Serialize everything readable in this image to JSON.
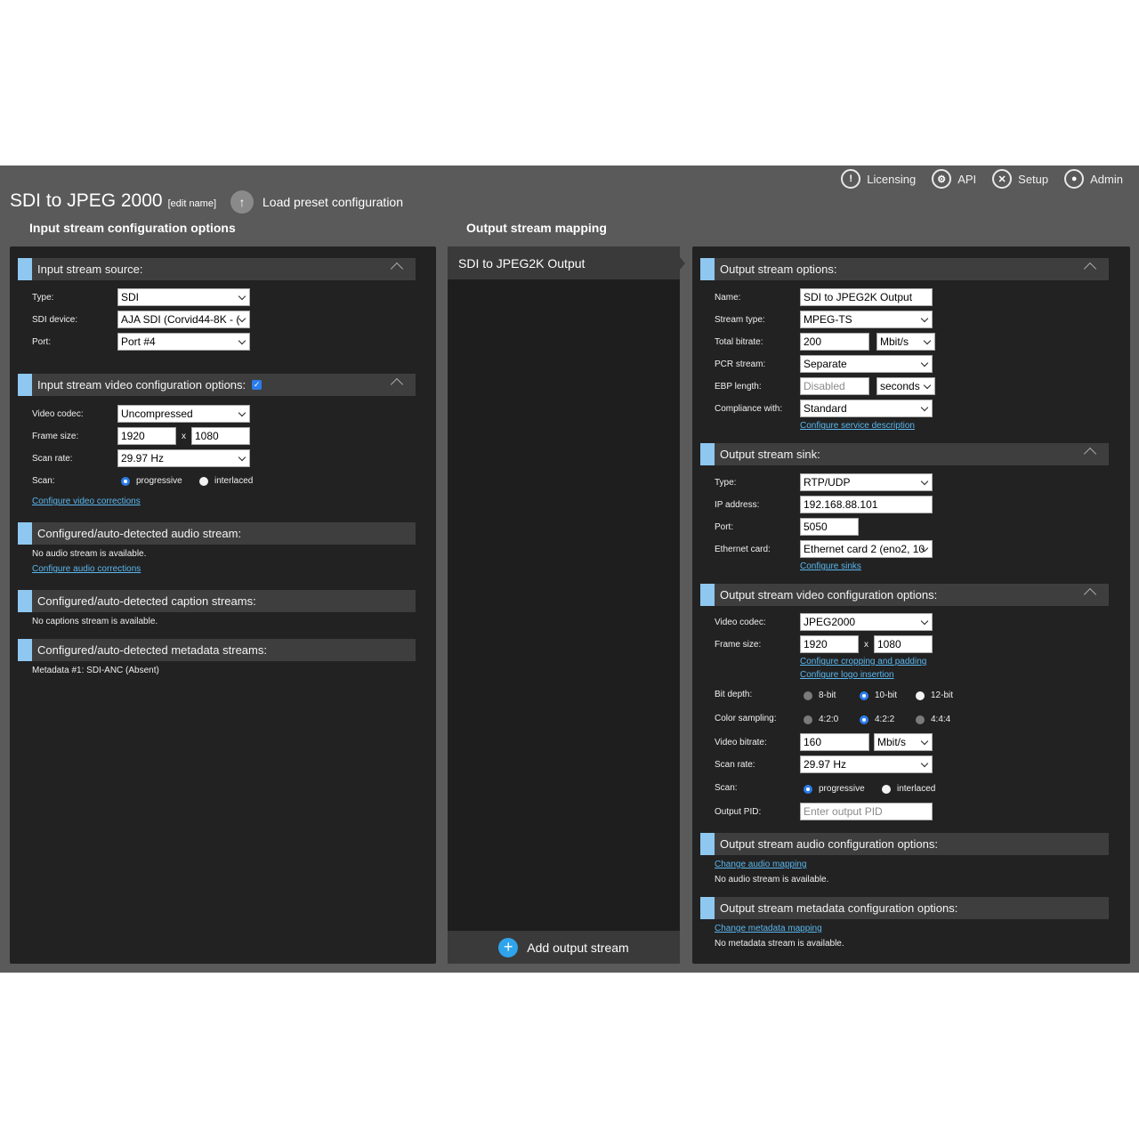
{
  "nav": {
    "licensing": "Licensing",
    "api": "API",
    "setup": "Setup",
    "admin": "Admin"
  },
  "header": {
    "title": "SDI to JPEG 2000",
    "edit_name": "[edit name]",
    "load_preset": "Load preset configuration",
    "input_heading": "Input stream configuration options",
    "output_mapping_heading": "Output stream mapping"
  },
  "input": {
    "source": {
      "title": "Input stream source:",
      "type_label": "Type:",
      "type_value": "SDI",
      "device_label": "SDI device:",
      "device_value": "AJA SDI (Corvid44-8K - (",
      "port_label": "Port:",
      "port_value": "Port #4"
    },
    "video": {
      "title": "Input stream video configuration options:",
      "codec_label": "Video codec:",
      "codec_value": "Uncompressed",
      "frame_label": "Frame size:",
      "frame_w": "1920",
      "frame_h": "1080",
      "x": "x",
      "scan_rate_label": "Scan rate:",
      "scan_rate_value": "29.97 Hz",
      "scan_label": "Scan:",
      "progressive": "progressive",
      "interlaced": "interlaced",
      "corrections_link": "Configure video corrections"
    },
    "audio": {
      "title": "Configured/auto-detected audio stream:",
      "status": "No audio stream is available.",
      "link": "Configure audio corrections"
    },
    "captions": {
      "title": "Configured/auto-detected caption streams:",
      "status": "No captions stream is available."
    },
    "metadata": {
      "title": "Configured/auto-detected metadata streams:",
      "item": "Metadata #1: SDI-ANC (Absent)"
    }
  },
  "mapping": {
    "output_name": "SDI to JPEG2K Output",
    "add_output": "Add output stream"
  },
  "output": {
    "options": {
      "title": "Output stream options:",
      "name_label": "Name:",
      "name_value": "SDI to JPEG2K Output",
      "stream_type_label": "Stream type:",
      "stream_type_value": "MPEG-TS",
      "bitrate_label": "Total bitrate:",
      "bitrate_value": "200",
      "bitrate_unit": "Mbit/s",
      "pcr_label": "PCR stream:",
      "pcr_value": "Separate",
      "ebp_label": "EBP length:",
      "ebp_placeholder": "Disabled",
      "ebp_unit": "seconds",
      "compliance_label": "Compliance with:",
      "compliance_value": "Standard",
      "service_link": "Configure service description"
    },
    "sink": {
      "title": "Output stream sink:",
      "type_label": "Type:",
      "type_value": "RTP/UDP",
      "ip_label": "IP address:",
      "ip_value": "192.168.88.101",
      "port_label": "Port:",
      "port_value": "5050",
      "eth_label": "Ethernet card:",
      "eth_value": "Ethernet card 2 (eno2, 10",
      "sinks_link": "Configure sinks"
    },
    "video": {
      "title": "Output stream video configuration options:",
      "codec_label": "Video codec:",
      "codec_value": "JPEG2000",
      "frame_label": "Frame size:",
      "frame_w": "1920",
      "frame_h": "1080",
      "x": "x",
      "crop_link": "Configure cropping and padding",
      "logo_link": "Configure logo insertion",
      "bitdepth_label": "Bit depth:",
      "bd_8": "8-bit",
      "bd_10": "10-bit",
      "bd_12": "12-bit",
      "sampling_label": "Color sampling:",
      "cs_420": "4:2:0",
      "cs_422": "4:2:2",
      "cs_444": "4:4:4",
      "vbitrate_label": "Video bitrate:",
      "vbitrate_value": "160",
      "vbitrate_unit": "Mbit/s",
      "scan_rate_label": "Scan rate:",
      "scan_rate_value": "29.97 Hz",
      "scan_label": "Scan:",
      "progressive": "progressive",
      "interlaced": "interlaced",
      "pid_label": "Output PID:",
      "pid_placeholder": "Enter output PID"
    },
    "audio": {
      "title": "Output stream audio configuration options:",
      "link": "Change audio mapping",
      "status": "No audio stream is available."
    },
    "metadata": {
      "title": "Output stream metadata configuration options:",
      "link": "Change metadata mapping",
      "status": "No metadata stream is available."
    }
  },
  "colors": {
    "accent": "#8ec7f0",
    "link": "#5ab7ee",
    "radio_selected": "#2b7de9"
  }
}
